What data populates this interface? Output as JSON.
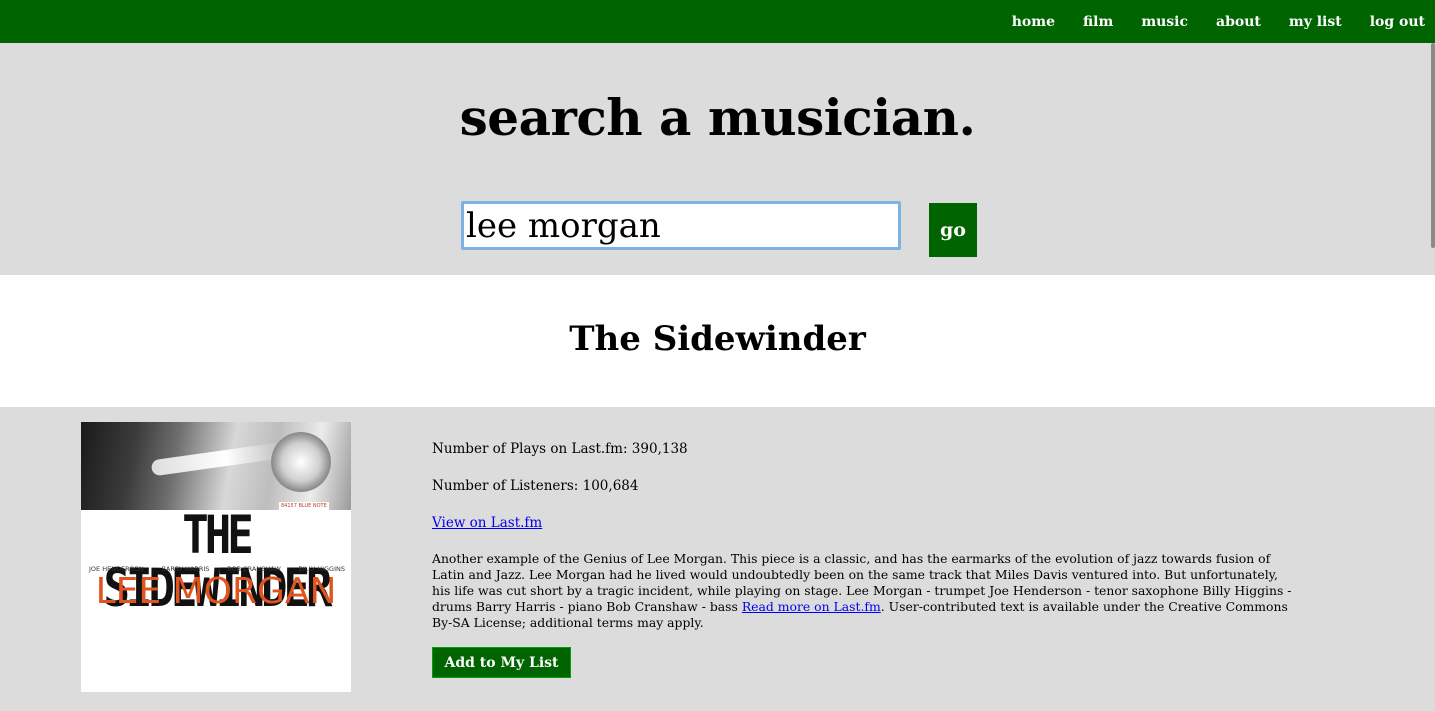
{
  "nav": {
    "items": [
      {
        "label": "home"
      },
      {
        "label": "film"
      },
      {
        "label": "music"
      },
      {
        "label": "about"
      },
      {
        "label": "my list"
      },
      {
        "label": "log out"
      }
    ]
  },
  "search": {
    "title": "search a musician.",
    "value": "lee morgan",
    "go_label": "go"
  },
  "album": {
    "title": "The Sidewinder",
    "cover": {
      "title_text": "THE SIDEWINDER",
      "artist_text": "LEE MORGAN",
      "musicians": [
        "JOE HENDERSON",
        "BARRY HARRIS",
        "BOB CRANSHAW",
        "BILLY HIGGINS"
      ],
      "label_text": "84157 BLUE NOTE"
    },
    "plays": "Number of Plays on Last.fm: 390,138",
    "listeners": "Number of Listeners: 100,684",
    "lastfm_link": "View on Last.fm",
    "bio_text": "Another example of the Genius of Lee Morgan. This piece is a classic, and has the earmarks of the evolution of jazz towards fusion of Latin and Jazz. Lee Morgan had he lived would undoubtedly been on the same track that Miles Davis ventured into. But unfortunately, his life was cut short by a tragic incident, while playing on stage. Lee Morgan - trumpet Joe Henderson - tenor saxophone Billy Higgins - drums Barry Harris - piano Bob Cranshaw - bass ",
    "read_more": "Read more on Last.fm",
    "license_text": ". User-contributed text is available under the Creative Commons By-SA License; additional terms may apply.",
    "add_button": "Add to My List"
  },
  "colors": {
    "nav_bg": "#006400",
    "page_bg": "#dcdcdc",
    "link": "#0000ee",
    "cover_artist": "#e2541e"
  }
}
